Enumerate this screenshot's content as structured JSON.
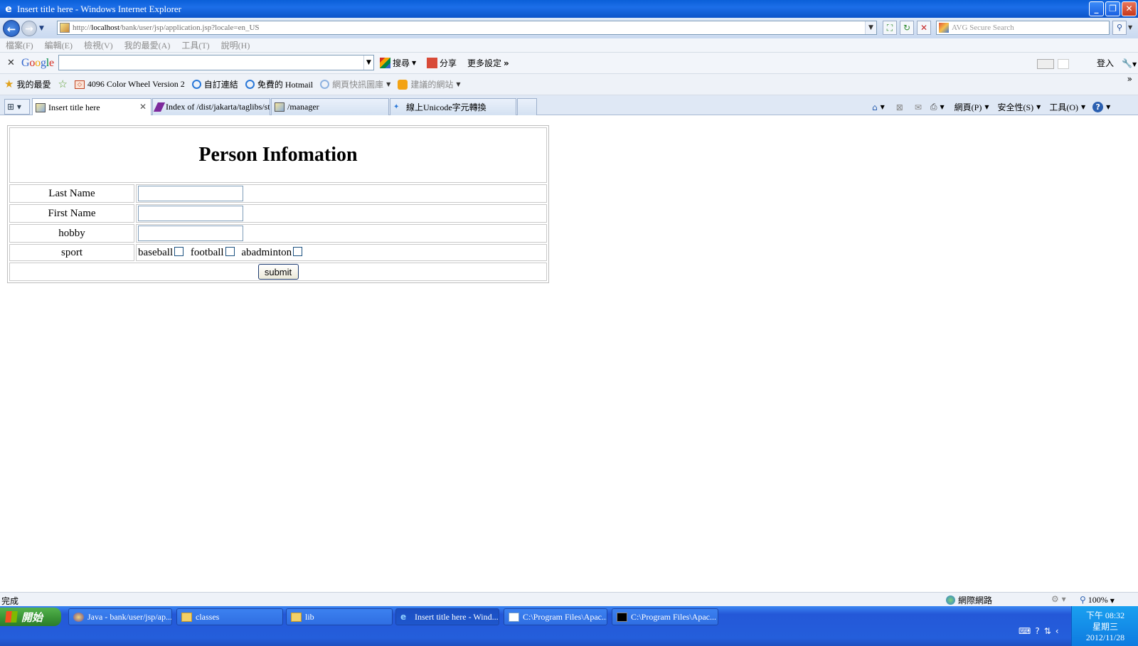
{
  "window": {
    "title": "Insert title here - Windows Internet Explorer",
    "minimize": "_",
    "restore": "❐",
    "close": "✕"
  },
  "address": {
    "url_prefix": "http://",
    "url_host": "localhost",
    "url_path": "/bank/user/jsp/application.jsp?locale=en_US",
    "search_placeholder": "AVG Secure Search"
  },
  "menubar": [
    "檔案(F)",
    "編輯(E)",
    "檢視(V)",
    "我的最愛(A)",
    "工具(T)",
    "說明(H)"
  ],
  "google_toolbar": {
    "logo": "Google",
    "search_label": "搜尋",
    "share_label": "分享",
    "more_label": "更多設定",
    "signin_label": "登入"
  },
  "favorites": {
    "label": "我的最愛",
    "items": [
      {
        "label": "4096 Color Wheel Version 2",
        "icon": "color-wheel-icon"
      },
      {
        "label": "自訂連結",
        "icon": "ie-page-icon"
      },
      {
        "label": "免費的 Hotmail",
        "icon": "ie-page-icon"
      },
      {
        "label": "網頁快訊圖庫",
        "icon": "ie-page-icon"
      },
      {
        "label": "建議的網站",
        "icon": "suggested-sites-icon"
      }
    ]
  },
  "tabs": [
    {
      "label": "Insert title here",
      "active": true
    },
    {
      "label": "Index of /dist/jakarta/taglibs/st...",
      "active": false
    },
    {
      "label": "/manager",
      "active": false
    },
    {
      "label": "線上Unicode字元轉換",
      "active": false
    }
  ],
  "command_bar": {
    "page": "網頁(P)",
    "safety": "安全性(S)",
    "tools": "工具(O)"
  },
  "form": {
    "heading": "Person Infomation",
    "fields": [
      {
        "label": "Last Name",
        "value": ""
      },
      {
        "label": "First Name",
        "value": ""
      },
      {
        "label": "hobby",
        "value": ""
      }
    ],
    "sport_label": "sport",
    "sports": [
      {
        "label": "baseball",
        "checked": false
      },
      {
        "label": "football",
        "checked": false
      },
      {
        "label": "abadminton",
        "checked": false
      }
    ],
    "submit_label": "submit"
  },
  "status": {
    "text": "完成",
    "zone": "網際網路",
    "zoom": "100%"
  },
  "taskbar": {
    "start_label": "開始",
    "tasks": [
      {
        "label": "Java - bank/user/jsp/ap...",
        "icon": "eclipse-icon"
      },
      {
        "label": "classes",
        "icon": "folder-icon"
      },
      {
        "label": "lib",
        "icon": "folder-icon"
      },
      {
        "label": "Insert title here - Wind...",
        "icon": "ie-icon"
      },
      {
        "label": "C:\\Program Files\\Apac...",
        "icon": "notepad-icon"
      },
      {
        "label": "C:\\Program Files\\Apac...",
        "icon": "console-icon"
      }
    ],
    "clock_time": "下午 08:32",
    "clock_day": "星期三",
    "clock_date": "2012/11/28"
  }
}
